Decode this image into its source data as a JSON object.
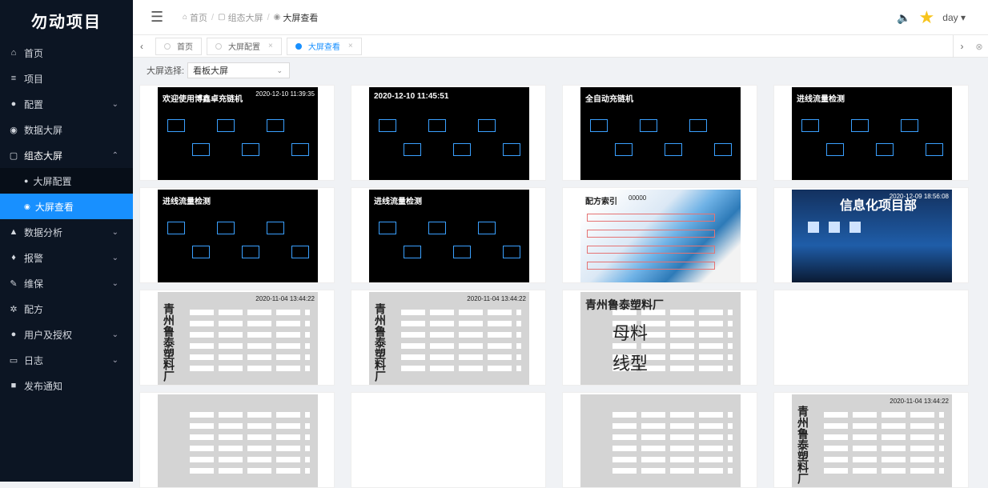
{
  "app": {
    "title": "勿动项目"
  },
  "sidebar": {
    "items": [
      {
        "label": "首页",
        "icon": "home-icon",
        "glyph": "⌂",
        "arrow": ""
      },
      {
        "label": "项目",
        "icon": "list-icon",
        "glyph": "≡",
        "arrow": ""
      },
      {
        "label": "配置",
        "icon": "config-icon",
        "glyph": "●",
        "arrow": "⌄"
      },
      {
        "label": "数据大屏",
        "icon": "screen-icon",
        "glyph": "◉",
        "arrow": ""
      },
      {
        "label": "组态大屏",
        "icon": "monitor-icon",
        "glyph": "▢",
        "arrow": "⌃"
      }
    ],
    "sub_items": [
      {
        "label": "大屏配置",
        "icon": "gear-icon",
        "glyph": "●"
      },
      {
        "label": "大屏查看",
        "icon": "eye-icon",
        "glyph": "◉"
      }
    ],
    "items2": [
      {
        "label": "数据分析",
        "icon": "chart-icon",
        "glyph": "▲",
        "arrow": "⌄"
      },
      {
        "label": "报警",
        "icon": "bell-icon",
        "glyph": "♦",
        "arrow": "⌄"
      },
      {
        "label": "维保",
        "icon": "wrench-icon",
        "glyph": "✎",
        "arrow": "⌄"
      },
      {
        "label": "配方",
        "icon": "formula-icon",
        "glyph": "✲",
        "arrow": ""
      },
      {
        "label": "用户及授权",
        "icon": "user-icon",
        "glyph": "●",
        "arrow": "⌄"
      },
      {
        "label": "日志",
        "icon": "log-icon",
        "glyph": "▭",
        "arrow": "⌄"
      },
      {
        "label": "发布通知",
        "icon": "notice-icon",
        "glyph": "■",
        "arrow": ""
      }
    ]
  },
  "header": {
    "breadcrumb": [
      "首页",
      "组态大屏",
      "大屏查看"
    ],
    "user": "day"
  },
  "tabs": [
    {
      "label": "首页",
      "closable": false,
      "active": false
    },
    {
      "label": "大屏配置",
      "closable": true,
      "active": false
    },
    {
      "label": "大屏查看",
      "closable": true,
      "active": true
    }
  ],
  "selector": {
    "label": "大屏选择:",
    "value": "看板大屏"
  },
  "cards": [
    {
      "style": "t-dark",
      "texts": [
        "欢迎使用博鑫卓充链机",
        "2020-12-10 11:39:35"
      ]
    },
    {
      "style": "t-dark",
      "texts": [
        "2020-12-10 11:45:51"
      ]
    },
    {
      "style": "t-dark",
      "texts": [
        "全自动充链机"
      ]
    },
    {
      "style": "t-dark",
      "texts": [
        "进线流量检测"
      ]
    },
    {
      "style": "t-dark",
      "texts": [
        "进线流量检测"
      ]
    },
    {
      "style": "t-dark",
      "texts": [
        "进线流量检测"
      ]
    },
    {
      "style": "t-wave",
      "texts": [
        "配方索引",
        "00000"
      ]
    },
    {
      "style": "t-navy",
      "texts": [
        "信息化项目部",
        "2020-12-09 18:56:08"
      ]
    },
    {
      "style": "t-gray",
      "texts": [
        "青州鲁泰塑料厂",
        "2020-11-04 13:44:22"
      ]
    },
    {
      "style": "t-gray",
      "texts": [
        "青州鲁泰塑料厂",
        "2020-11-04 13:44:22"
      ]
    },
    {
      "style": "t-gray",
      "texts": [
        "青州鲁泰塑料厂",
        "母料",
        "线型"
      ]
    },
    {
      "style": "empty",
      "texts": []
    },
    {
      "style": "t-gray",
      "texts": []
    },
    {
      "style": "empty",
      "texts": []
    },
    {
      "style": "t-gray",
      "texts": []
    },
    {
      "style": "t-gray",
      "texts": [
        "青州鲁泰塑料厂",
        "2020-11-04 13:44:22"
      ]
    }
  ]
}
